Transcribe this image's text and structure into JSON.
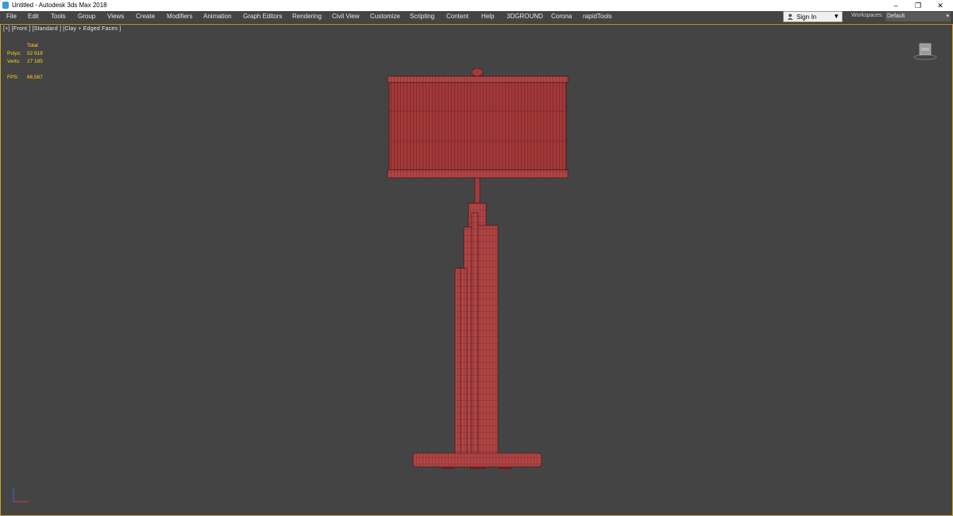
{
  "window": {
    "title": "Untitled - Autodesk 3ds Max 2018",
    "minimize": "–",
    "restore": "❐",
    "close": "✕"
  },
  "menu": [
    "File",
    "Edit",
    "Tools",
    "Group",
    "Views",
    "Create",
    "Modifiers",
    "Animation",
    "Graph Editors",
    "Rendering",
    "Civil View",
    "Customize",
    "Scripting",
    "Content",
    "Help",
    "3DGROUND",
    "Corona",
    "rapidTools"
  ],
  "signin": {
    "label": "Sign In"
  },
  "workspaces": {
    "label": "Workspaces:",
    "value": "Default"
  },
  "viewport": {
    "label": "[+] [Front ] [Standard ] [Clay + Edged Faces ]",
    "stats": {
      "total_label": "Total",
      "polys_label": "Polys:",
      "polys_value": "52 918",
      "verts_label": "Verts:",
      "verts_value": "27 185",
      "fps_label": "FPS:",
      "fps_value": "66,567"
    }
  },
  "colors": {
    "wire": "#a83a3a",
    "wire_light": "#c46060",
    "viewport_bg": "#444444",
    "active_border": "#c9a227",
    "stats": "#ffd21f"
  }
}
